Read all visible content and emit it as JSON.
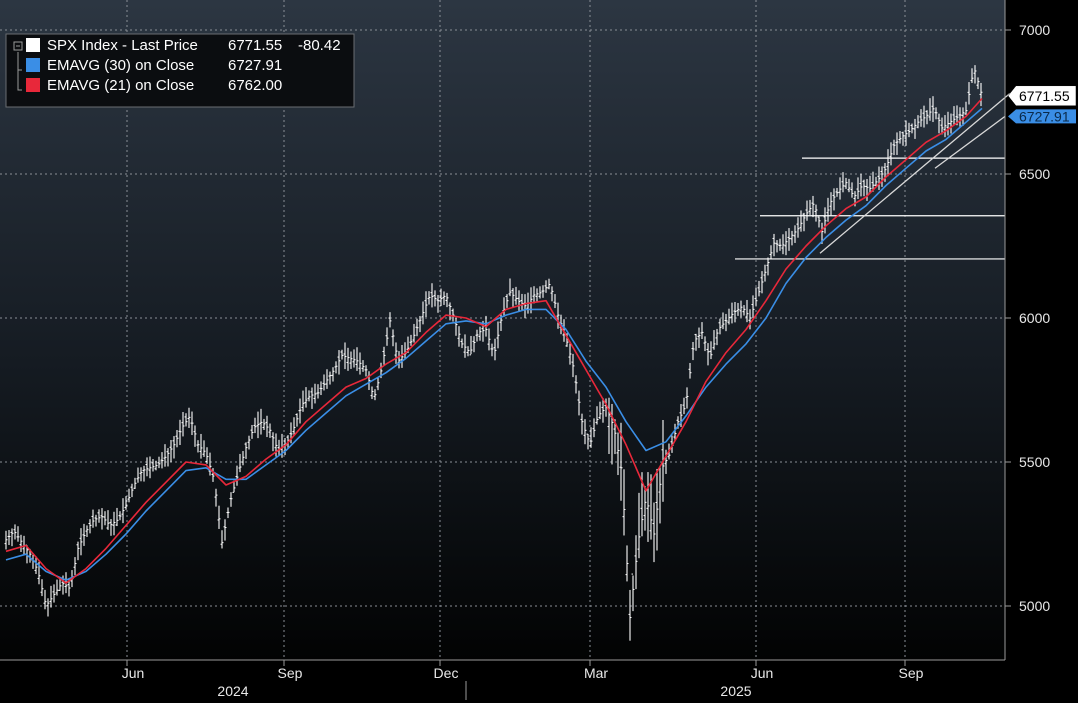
{
  "chart_data": {
    "type": "line",
    "ylim": [
      4800,
      7100
    ],
    "y_ticks": [
      "5000",
      "5500",
      "6000",
      "6500",
      "7000"
    ],
    "x_month_ticks": [
      "Jun",
      "Sep",
      "Dec",
      "Mar",
      "Jun",
      "Sep"
    ],
    "x_year_labels": [
      "2024",
      "2025"
    ],
    "grid": true,
    "legend_position": "top-left",
    "legend": [
      {
        "label": "SPX Index - Last Price",
        "value": "6771.55",
        "change": "-80.42",
        "color": "#ffffff"
      },
      {
        "label": "EMAVG (30)  on Close",
        "value": "6727.91",
        "color": "#3a8ee6"
      },
      {
        "label": "EMAVG (21)  on Close",
        "value": "6762.00",
        "color": "#e8283a"
      }
    ],
    "last_price_tag": "6771.55",
    "ema30_tag": "6727.91",
    "series": [
      {
        "name": "SPX Index - Last Price",
        "style": "ohlc-bars",
        "color": "#ffffff",
        "points": [
          [
            0,
            5230
          ],
          [
            8,
            5260
          ],
          [
            16,
            5220
          ],
          [
            24,
            5180
          ],
          [
            32,
            5120
          ],
          [
            40,
            5000
          ],
          [
            48,
            5040
          ],
          [
            56,
            5080
          ],
          [
            64,
            5060
          ],
          [
            72,
            5200
          ],
          [
            80,
            5260
          ],
          [
            88,
            5300
          ],
          [
            96,
            5310
          ],
          [
            104,
            5280
          ],
          [
            112,
            5300
          ],
          [
            120,
            5350
          ],
          [
            128,
            5420
          ],
          [
            136,
            5470
          ],
          [
            144,
            5480
          ],
          [
            152,
            5490
          ],
          [
            160,
            5520
          ],
          [
            168,
            5560
          ],
          [
            176,
            5620
          ],
          [
            184,
            5660
          ],
          [
            192,
            5560
          ],
          [
            200,
            5530
          ],
          [
            208,
            5440
          ],
          [
            216,
            5220
          ],
          [
            224,
            5360
          ],
          [
            232,
            5460
          ],
          [
            240,
            5550
          ],
          [
            248,
            5620
          ],
          [
            256,
            5640
          ],
          [
            264,
            5610
          ],
          [
            272,
            5540
          ],
          [
            280,
            5560
          ],
          [
            288,
            5620
          ],
          [
            296,
            5700
          ],
          [
            304,
            5730
          ],
          [
            312,
            5740
          ],
          [
            320,
            5780
          ],
          [
            328,
            5820
          ],
          [
            336,
            5870
          ],
          [
            344,
            5860
          ],
          [
            352,
            5850
          ],
          [
            360,
            5820
          ],
          [
            368,
            5720
          ],
          [
            376,
            5830
          ],
          [
            384,
            5990
          ],
          [
            392,
            5850
          ],
          [
            400,
            5880
          ],
          [
            408,
            5940
          ],
          [
            416,
            6010
          ],
          [
            424,
            6080
          ],
          [
            432,
            6060
          ],
          [
            440,
            6080
          ],
          [
            448,
            6000
          ],
          [
            456,
            5910
          ],
          [
            464,
            5880
          ],
          [
            472,
            5950
          ],
          [
            480,
            5960
          ],
          [
            488,
            5870
          ],
          [
            496,
            6010
          ],
          [
            504,
            6090
          ],
          [
            512,
            6060
          ],
          [
            520,
            6040
          ],
          [
            528,
            6080
          ],
          [
            536,
            6090
          ],
          [
            544,
            6120
          ],
          [
            552,
            6010
          ],
          [
            560,
            5930
          ],
          [
            568,
            5820
          ],
          [
            576,
            5640
          ],
          [
            584,
            5560
          ],
          [
            592,
            5660
          ],
          [
            600,
            5690
          ],
          [
            608,
            5620
          ],
          [
            616,
            5460
          ],
          [
            624,
            4960
          ],
          [
            632,
            5220
          ],
          [
            640,
            5380
          ],
          [
            648,
            5250
          ],
          [
            656,
            5480
          ],
          [
            664,
            5530
          ],
          [
            672,
            5640
          ],
          [
            680,
            5700
          ],
          [
            688,
            5920
          ],
          [
            696,
            5950
          ],
          [
            704,
            5860
          ],
          [
            712,
            5960
          ],
          [
            720,
            5990
          ],
          [
            728,
            6020
          ],
          [
            736,
            6040
          ],
          [
            744,
            6000
          ],
          [
            752,
            6080
          ],
          [
            760,
            6170
          ],
          [
            768,
            6260
          ],
          [
            776,
            6250
          ],
          [
            784,
            6280
          ],
          [
            792,
            6310
          ],
          [
            800,
            6360
          ],
          [
            808,
            6400
          ],
          [
            816,
            6300
          ],
          [
            824,
            6400
          ],
          [
            832,
            6440
          ],
          [
            840,
            6470
          ],
          [
            848,
            6420
          ],
          [
            856,
            6460
          ],
          [
            864,
            6450
          ],
          [
            872,
            6480
          ],
          [
            880,
            6520
          ],
          [
            888,
            6600
          ],
          [
            896,
            6630
          ],
          [
            904,
            6650
          ],
          [
            912,
            6680
          ],
          [
            920,
            6700
          ],
          [
            928,
            6730
          ],
          [
            936,
            6660
          ],
          [
            944,
            6680
          ],
          [
            952,
            6700
          ],
          [
            960,
            6720
          ],
          [
            968,
            6870
          ],
          [
            976,
            6771.55
          ]
        ]
      },
      {
        "name": "EMAVG (30)  on Close",
        "style": "line",
        "color": "#3a8ee6",
        "points": [
          [
            0,
            5160
          ],
          [
            20,
            5180
          ],
          [
            40,
            5120
          ],
          [
            60,
            5090
          ],
          [
            80,
            5120
          ],
          [
            100,
            5180
          ],
          [
            120,
            5250
          ],
          [
            140,
            5330
          ],
          [
            160,
            5400
          ],
          [
            180,
            5470
          ],
          [
            200,
            5480
          ],
          [
            220,
            5440
          ],
          [
            240,
            5440
          ],
          [
            260,
            5490
          ],
          [
            280,
            5540
          ],
          [
            300,
            5610
          ],
          [
            320,
            5670
          ],
          [
            340,
            5730
          ],
          [
            360,
            5770
          ],
          [
            380,
            5810
          ],
          [
            400,
            5860
          ],
          [
            420,
            5920
          ],
          [
            440,
            5980
          ],
          [
            460,
            5990
          ],
          [
            480,
            5980
          ],
          [
            500,
            6010
          ],
          [
            520,
            6030
          ],
          [
            540,
            6030
          ],
          [
            560,
            5960
          ],
          [
            580,
            5850
          ],
          [
            600,
            5760
          ],
          [
            620,
            5640
          ],
          [
            640,
            5540
          ],
          [
            660,
            5570
          ],
          [
            680,
            5660
          ],
          [
            700,
            5760
          ],
          [
            720,
            5840
          ],
          [
            740,
            5910
          ],
          [
            760,
            6000
          ],
          [
            780,
            6120
          ],
          [
            800,
            6210
          ],
          [
            820,
            6280
          ],
          [
            840,
            6340
          ],
          [
            860,
            6390
          ],
          [
            880,
            6460
          ],
          [
            900,
            6520
          ],
          [
            920,
            6580
          ],
          [
            940,
            6620
          ],
          [
            960,
            6680
          ],
          [
            976,
            6727.91
          ]
        ]
      },
      {
        "name": "EMAVG (21)  on Close",
        "style": "line",
        "color": "#e8283a",
        "points": [
          [
            0,
            5190
          ],
          [
            20,
            5210
          ],
          [
            40,
            5130
          ],
          [
            60,
            5080
          ],
          [
            80,
            5130
          ],
          [
            100,
            5200
          ],
          [
            120,
            5280
          ],
          [
            140,
            5360
          ],
          [
            160,
            5430
          ],
          [
            180,
            5500
          ],
          [
            200,
            5490
          ],
          [
            220,
            5420
          ],
          [
            240,
            5450
          ],
          [
            260,
            5510
          ],
          [
            280,
            5560
          ],
          [
            300,
            5640
          ],
          [
            320,
            5700
          ],
          [
            340,
            5760
          ],
          [
            360,
            5790
          ],
          [
            380,
            5840
          ],
          [
            400,
            5880
          ],
          [
            420,
            5950
          ],
          [
            440,
            6010
          ],
          [
            460,
            6000
          ],
          [
            480,
            5970
          ],
          [
            500,
            6030
          ],
          [
            520,
            6050
          ],
          [
            540,
            6060
          ],
          [
            560,
            5940
          ],
          [
            580,
            5820
          ],
          [
            600,
            5700
          ],
          [
            620,
            5560
          ],
          [
            640,
            5400
          ],
          [
            660,
            5520
          ],
          [
            680,
            5640
          ],
          [
            700,
            5780
          ],
          [
            720,
            5880
          ],
          [
            740,
            5960
          ],
          [
            760,
            6060
          ],
          [
            780,
            6170
          ],
          [
            800,
            6250
          ],
          [
            820,
            6320
          ],
          [
            840,
            6380
          ],
          [
            860,
            6420
          ],
          [
            880,
            6490
          ],
          [
            900,
            6550
          ],
          [
            920,
            6610
          ],
          [
            940,
            6650
          ],
          [
            960,
            6700
          ],
          [
            976,
            6762.0
          ]
        ]
      }
    ],
    "horizontal_lines": [
      {
        "y": 6555,
        "x_start": 802,
        "x_end": 1005
      },
      {
        "y": 6355,
        "x_start": 760,
        "x_end": 1005
      },
      {
        "y": 6205,
        "x_start": 735,
        "x_end": 1005
      }
    ],
    "trend_lines": [
      {
        "from": [
          820,
          6225
        ],
        "to": [
          1010,
          6780
        ]
      },
      {
        "from": [
          935,
          6520
        ],
        "to": [
          1005,
          6700
        ]
      }
    ]
  }
}
